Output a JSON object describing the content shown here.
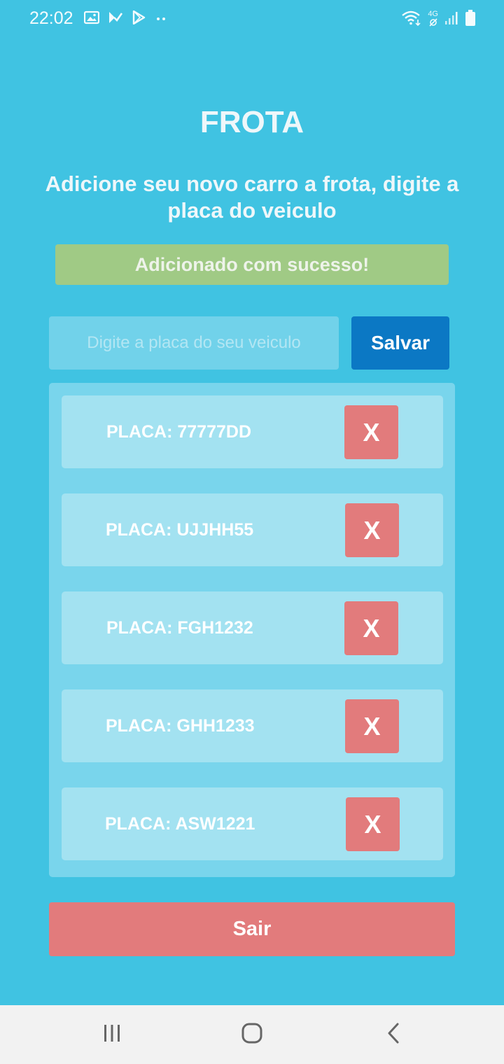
{
  "status_bar": {
    "time": "22:02",
    "network_label": "4G"
  },
  "page": {
    "title": "FROTA",
    "subtitle": "Adicione seu novo carro a frota, digite a placa do veiculo",
    "success_message": "Adicionado com sucesso!"
  },
  "form": {
    "input_placeholder": "Digite a placa do seu veiculo",
    "input_value": "",
    "save_label": "Salvar"
  },
  "vehicles": [
    {
      "label": "PLACA: 77777DD",
      "remove_label": "X"
    },
    {
      "label": "PLACA: UJJHH55",
      "remove_label": "X"
    },
    {
      "label": "PLACA: FGH1232",
      "remove_label": "X"
    },
    {
      "label": "PLACA: GHH1233",
      "remove_label": "X"
    },
    {
      "label": "PLACA: ASW1221",
      "remove_label": "X"
    }
  ],
  "footer": {
    "exit_label": "Sair"
  },
  "colors": {
    "background": "#40c3e2",
    "success": "#a0ca85",
    "primary": "#0b78c4",
    "danger": "#e27b7c"
  }
}
